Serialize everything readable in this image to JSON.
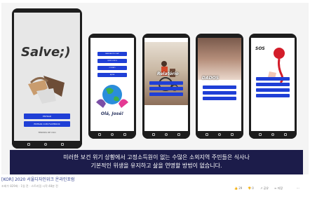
{
  "phone1": {
    "title": "Salve;)",
    "buttons": [
      "ENTRAR",
      "ENTRAR COM FACEBOOK"
    ],
    "link": "TERMOS DE USO"
  },
  "phone2": {
    "buttons": [
      "NAVEGAR PELO APP",
      "QUEM SOMOS",
      "CONTATO",
      "AJUDA"
    ],
    "greeting": "Olá, José!"
  },
  "phone3": {
    "heading": "Relatório"
  },
  "phone4": {
    "heading": "DADOS"
  },
  "phone5": {
    "heading": "SOS"
  },
  "subtitle": {
    "line1": "미러한 보건 위기 상황에서 고정소득원이 없는 수많은 소외지역 주민들은 식사나",
    "line2": "기본적인 위생을 유지하고 삶을 연명할 방법이 없습니다."
  },
  "video": {
    "title": "[KOR] 2020 서울디자인위크 온라인포럼",
    "meta": "조회수 829회 · 1일 전 · 스트리밍 시작 48분 전",
    "likes": "29",
    "dislikes": "0",
    "share": "공유",
    "save": "저장"
  }
}
